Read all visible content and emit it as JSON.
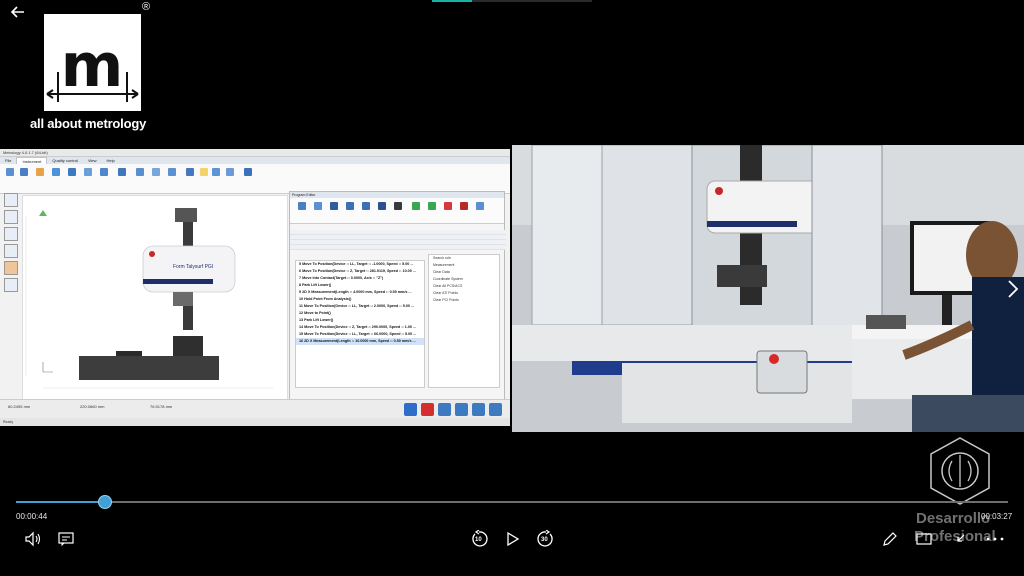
{
  "logo": {
    "letter": "m",
    "registered": "®",
    "caption": "all about metrology"
  },
  "software": {
    "title": "Metrology 4.0.1.7 (64-bit)",
    "tabs": [
      "File",
      "Instrument",
      "Quality control",
      "View",
      "Help"
    ],
    "program_panel_title": "Program Editor",
    "program_tab": "Program Editor",
    "code_lines": [
      "5  Move To Position(Device :: LL, Target :: -1.0000, Speed :: 5.00 ...",
      "6  Move To Position(Device :: Z, Target :: 281.9119, Speed :: 10.00 ...",
      "7  Move Into Contact(Target :: 0.0000, Axis :: \"Z\")",
      "8  Park Lift Lower()",
      "9  2D X Measurement(Length :: 4.0000 mm, Speed :: 0.50 mm/s ...",
      "10 Hold Point From Analysis()",
      "11 Move To Position(Device :: LL, Target :: 2.0000, Speed :: 5.00 ...",
      "12 Move to Point()",
      "13 Park Lift Lower()",
      "14 Move To Position(Device :: Z, Target :: 290.0000, Speed :: 1.00 ...",
      "15 Move To Position(Device :: LL, Target :: 66.0000, Speed :: 5.00 ...",
      "16 2D X Measurement(Length :: 10.0000 mm, Speed :: 0.50 mm/s ..."
    ],
    "tree_items": [
      "Search rule",
      "Measurement",
      "Clear Data",
      "Coordinate System",
      "Clear All PCS/ACS",
      "Clear ATI Points",
      "Clear PCI Points"
    ],
    "status_text": "Ready",
    "readouts": [
      "60.2495 mm",
      "220.0660 mm",
      "76.5178 mm"
    ]
  },
  "player": {
    "current_time": "00:00:44",
    "duration": "00:03:27",
    "progress": 0.09,
    "skip_back": "10",
    "skip_forward": "30"
  },
  "brand": {
    "line1": "Desarrollo",
    "line2": "Profesional"
  },
  "colors": {
    "accent": "#3fa1d8",
    "teal": "#13b3a8"
  }
}
